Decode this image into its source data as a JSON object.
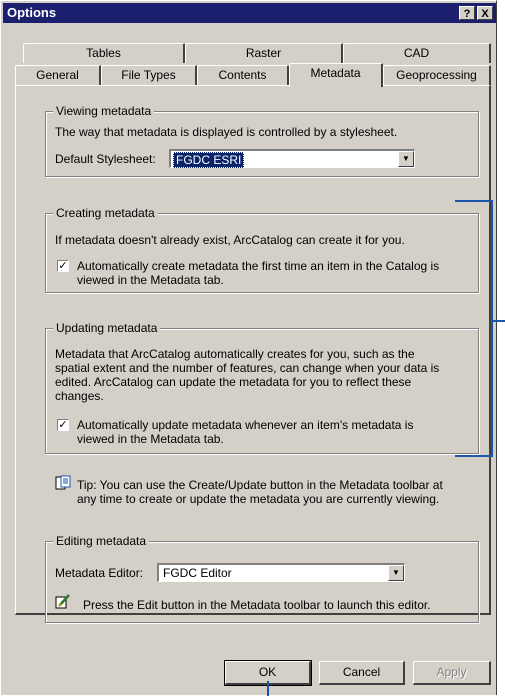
{
  "window": {
    "title": "Options",
    "help_btn": "?",
    "close_btn": "X"
  },
  "tabs": {
    "row1": [
      "Tables",
      "Raster",
      "CAD"
    ],
    "row2": [
      "General",
      "File Types",
      "Contents",
      "Metadata",
      "Geoprocessing"
    ],
    "active": "Metadata"
  },
  "viewing": {
    "legend": "Viewing metadata",
    "description": "The way that metadata is displayed is controlled by a stylesheet.",
    "stylesheet_label": "Default Stylesheet:",
    "stylesheet_value": "FGDC ESRI"
  },
  "creating": {
    "legend": "Creating metadata",
    "description": "If metadata doesn't already exist, ArcCatalog can create it for you.",
    "checkbox_line1": "Automatically create metadata the first time an item in the Catalog is",
    "checkbox_line2": "viewed in the Metadata tab.",
    "checked": true
  },
  "updating": {
    "legend": "Updating metadata",
    "desc_line1": "Metadata that ArcCatalog automatically creates for you, such as the",
    "desc_line2": "spatial extent and the number of features, can change when your data is",
    "desc_line3": "edited.  ArcCatalog can update the metadata for you to reflect these",
    "desc_line4": "changes.",
    "checkbox_line1": "Automatically update metadata whenever an item's metadata is",
    "checkbox_line2": "viewed in the Metadata tab.",
    "checked": true
  },
  "tip": {
    "line1": "Tip: You can use the Create/Update button in the Metadata toolbar at",
    "line2": "any time to create or update the metadata you are currently viewing."
  },
  "editing": {
    "legend": "Editing metadata",
    "editor_label": "Metadata Editor:",
    "editor_value": "FGDC Editor",
    "hint": "Press the Edit button in the Metadata toolbar to launch this editor."
  },
  "buttons": {
    "ok": "OK",
    "cancel": "Cancel",
    "apply": "Apply"
  },
  "colors": {
    "titlebar": "#1b1f6e",
    "selection": "#0a246a",
    "callout": "#1a56b0",
    "face": "#d4d0c8"
  }
}
